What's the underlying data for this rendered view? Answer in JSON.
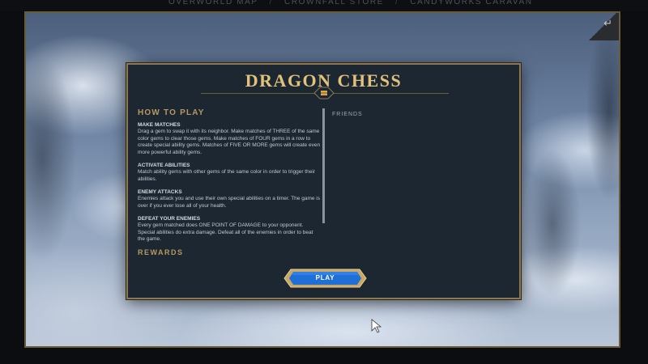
{
  "nav": {
    "items": [
      "OVERWORLD MAP",
      "CROWNFALL STORE",
      "CANDYWORKS CARAVAN"
    ],
    "separator": "/"
  },
  "back_icon": "back-arrow-icon",
  "modal": {
    "title": "DRAGON CHESS",
    "emblem_icon": "treasure-chest-icon",
    "how_to_play": "HOW TO PLAY",
    "sections": [
      {
        "heading": "MAKE MATCHES",
        "text": "Drag a gem to swap it with its neighbor. Make matches of THREE of the same color gems to clear those gems. Make matches of FOUR gems in a row to create special ability gems. Matches of FIVE OR MORE gems will create even more powerful ability gems."
      },
      {
        "heading": "ACTIVATE ABILITIES",
        "text": "Match ability gems with other gems of the same color in order to trigger their abilities."
      },
      {
        "heading": "ENEMY ATTACKS",
        "text": "Enemies attack you and use their own special abilities on a timer. The game is over if you ever lose all of your health."
      },
      {
        "heading": "DEFEAT YOUR ENEMIES",
        "text": "Every gem matched does ONE POINT OF DAMAGE to your opponent. Special abilities do extra damage. Defeat all of the enemies in order to beat the game."
      }
    ],
    "rewards": "REWARDS",
    "friends": "FRIENDS",
    "play_label": "PLAY"
  },
  "colors": {
    "gold": "#e2c27a",
    "panel": "#1c2732",
    "play_blue": "#1f6fd6"
  }
}
